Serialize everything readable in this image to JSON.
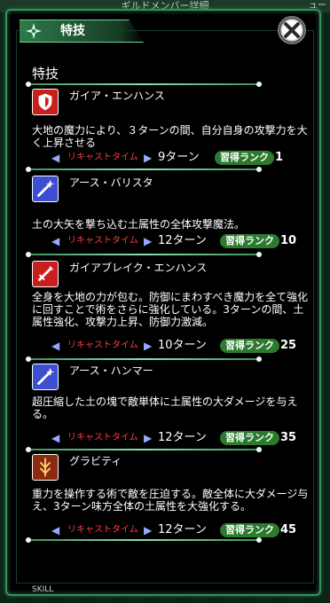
{
  "topbar": {
    "title": "ギルドメンバー詳細",
    "right": "ュー"
  },
  "header": {
    "title": "特技"
  },
  "section_label": "特技",
  "footer_label": "SKILL",
  "meta_labels": {
    "recast": "リキャストタイム",
    "rank": "習得ランク"
  },
  "skills": [
    {
      "name": "ガイア・エンハンス",
      "desc": "大地の魔力により、３ターンの間、自分自身の攻撃力を大く上昇させる",
      "turns": "9ターン",
      "rank": "1",
      "icon": "shield-icon"
    },
    {
      "name": "アース・バリスタ",
      "desc": "土の大矢を撃ち込む土属性の全体攻撃魔法。",
      "turns": "12ターン",
      "rank": "10",
      "icon": "wand-icon"
    },
    {
      "name": "ガイアブレイク・エンハンス",
      "desc": "全身を大地の力が包む。防御にまわすべき魔力を全て強化に回すことで術をさらに強化している。3ターンの間、土属性強化、攻撃力上昇、防御力激減。",
      "turns": "10ターン",
      "rank": "25",
      "icon": "sword-icon"
    },
    {
      "name": "アース・ハンマー",
      "desc": "超圧縮した土の塊で敵単体に土属性の大ダメージを与える。",
      "turns": "12ターン",
      "rank": "35",
      "icon": "wand-icon"
    },
    {
      "name": "グラビティ",
      "desc": "重力を操作する術で敵を圧迫する。敵全体に大ダメージ与え、3ターン味方全体の土属性を大強化する。",
      "turns": "12ターン",
      "rank": "45",
      "icon": "gravity-icon"
    }
  ],
  "colors": {
    "accent": "#3a8f5a",
    "badge": "#2c7a2e",
    "recast": "#ff3b3b"
  }
}
